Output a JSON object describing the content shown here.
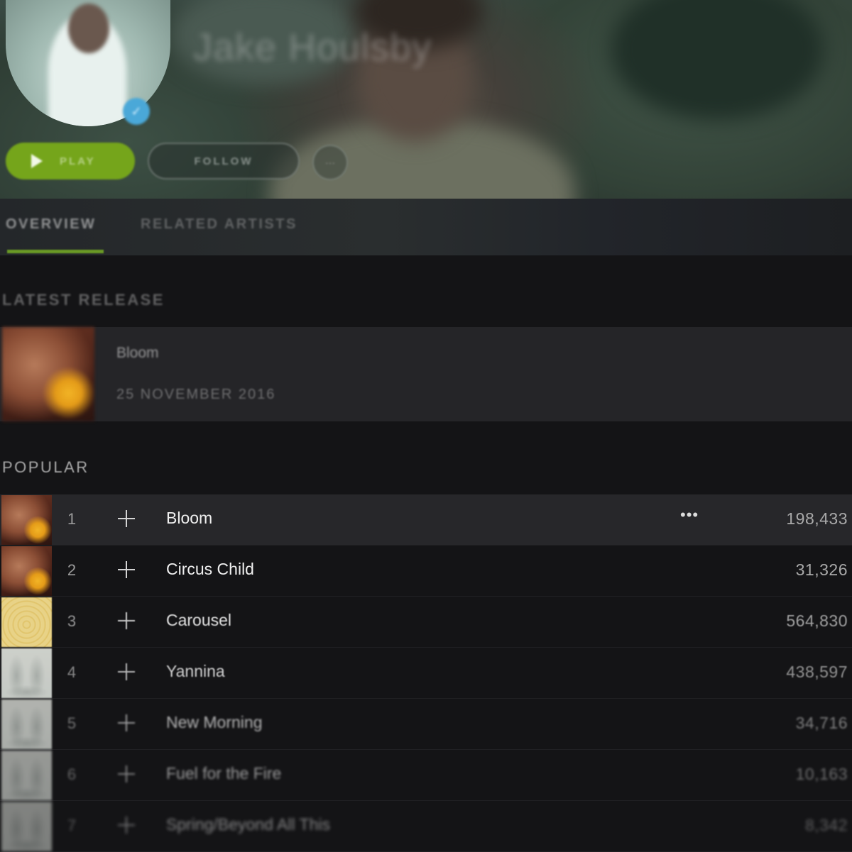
{
  "hero": {
    "artist_name": "Jake Houlsby",
    "play_label": "PLAY",
    "follow_label": "FOLLOW",
    "more_label": "···"
  },
  "tabs": [
    {
      "label": "OVERVIEW",
      "active": true
    },
    {
      "label": "RELATED ARTISTS",
      "active": false
    }
  ],
  "latest_release": {
    "section_title": "LATEST RELEASE",
    "name": "Bloom",
    "date": "25 NOVEMBER 2016"
  },
  "popular": {
    "section_title": "POPULAR",
    "tracks": [
      {
        "num": "1",
        "name": "Bloom",
        "plays": "198,433",
        "cover": "bloom",
        "more": "•••"
      },
      {
        "num": "2",
        "name": "Circus Child",
        "plays": "31,326",
        "cover": "bloom"
      },
      {
        "num": "3",
        "name": "Carousel",
        "plays": "564,830",
        "cover": "rings"
      },
      {
        "num": "4",
        "name": "Yannina",
        "plays": "438,597",
        "cover": "sketch"
      },
      {
        "num": "5",
        "name": "New Morning",
        "plays": "34,716",
        "cover": "sketch"
      },
      {
        "num": "6",
        "name": "Fuel for the Fire",
        "plays": "10,163",
        "cover": "sketch"
      },
      {
        "num": "7",
        "name": "Spring/Beyond All This",
        "plays": "8,342",
        "cover": "sketch"
      }
    ]
  },
  "colors": {
    "accent_green": "#75a51b",
    "tab_indicator": "#6a9a25",
    "background": "#141416",
    "row_active": "#27272a"
  }
}
